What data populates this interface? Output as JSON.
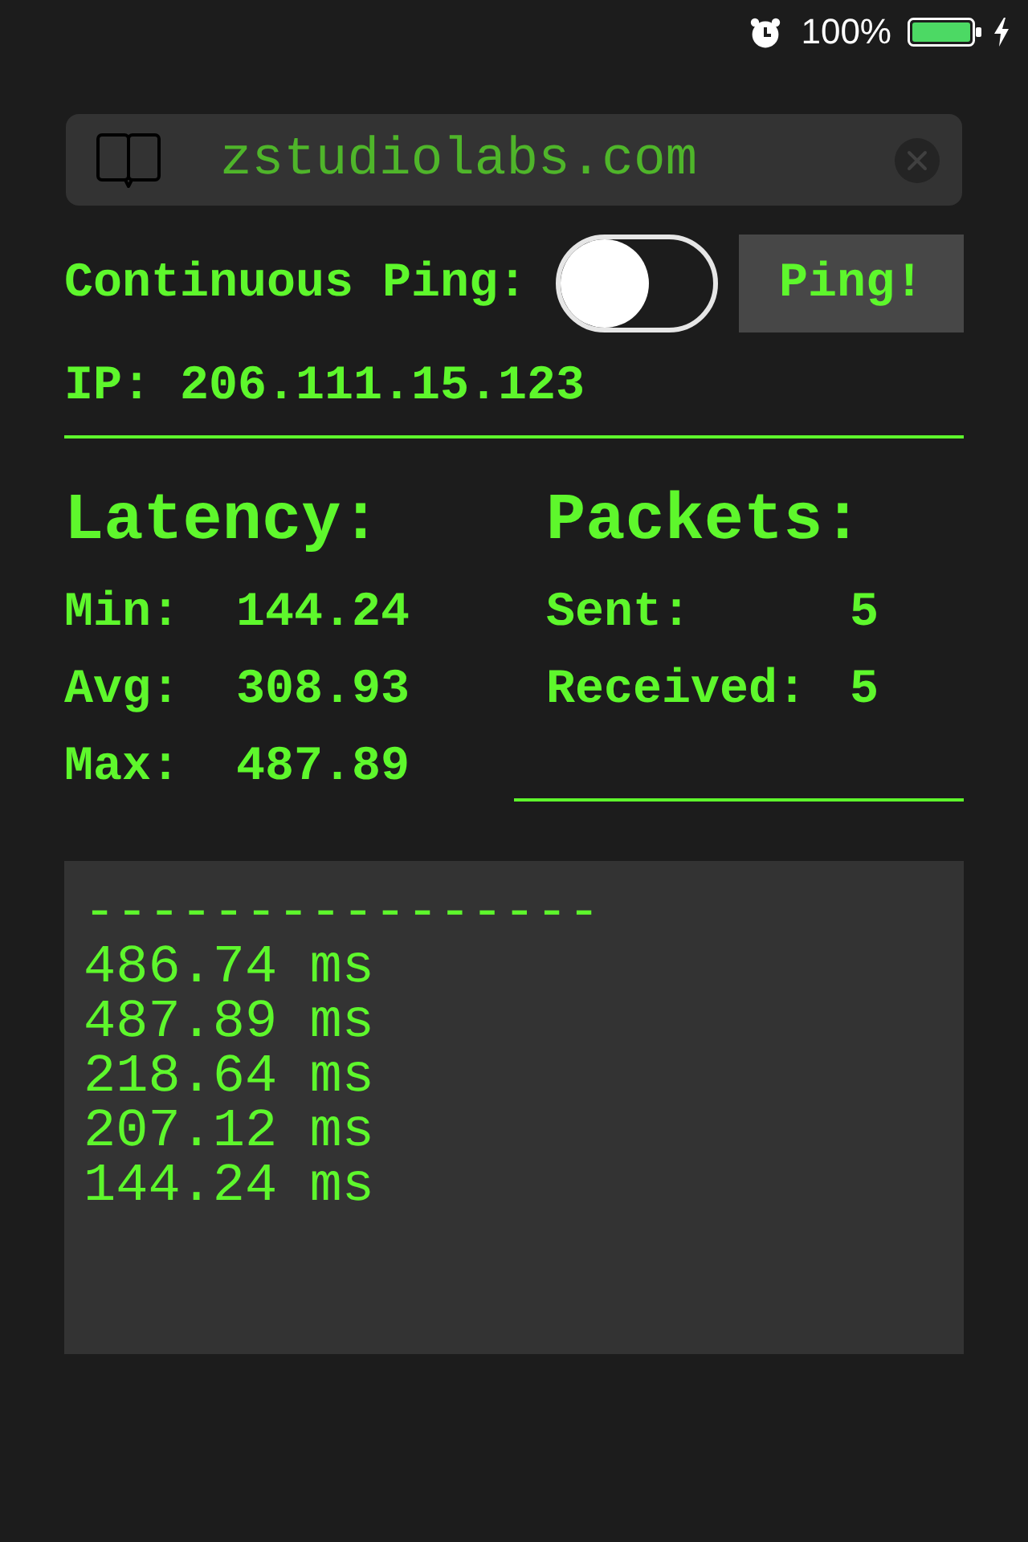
{
  "status_bar": {
    "alarm": true,
    "battery": "100%",
    "charging": true
  },
  "host_field": {
    "value": "zstudiolabs.com"
  },
  "continuous_ping": {
    "label": "Continuous Ping:",
    "on": false
  },
  "ping_button": {
    "label": "Ping!"
  },
  "ip": "IP: 206.111.15.123",
  "latency": {
    "title": "Latency:",
    "rows": [
      {
        "label": "Min:",
        "value": "144.24"
      },
      {
        "label": "Avg:",
        "value": "308.93"
      },
      {
        "label": "Max:",
        "value": "487.89"
      }
    ]
  },
  "packets": {
    "title": "Packets:",
    "rows": [
      {
        "label": "Sent:",
        "value": "5"
      },
      {
        "label": "Received:",
        "value": "5"
      }
    ]
  },
  "log": {
    "lines": [
      "----------------",
      "486.74 ms",
      "487.89 ms",
      "218.64 ms",
      "207.12 ms",
      "144.24 ms"
    ]
  }
}
